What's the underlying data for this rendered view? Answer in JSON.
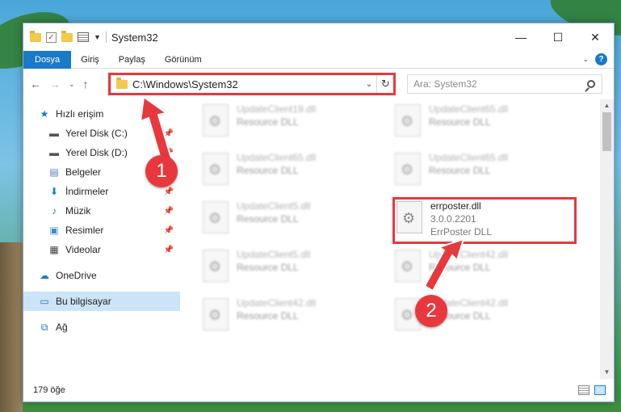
{
  "window": {
    "title": "System32",
    "controls": {
      "minimize": "—",
      "maximize": "☐",
      "close": "✕"
    }
  },
  "ribbon": {
    "tabs": [
      "Dosya",
      "Giriş",
      "Paylaş",
      "Görünüm"
    ],
    "help": "?"
  },
  "address": {
    "path": "C:\\Windows\\System32",
    "search_placeholder": "Ara: System32"
  },
  "sidebar": {
    "quick_access": "Hızlı erişim",
    "items": [
      {
        "label": "Yerel Disk (C:)",
        "icon": "drive-icon",
        "pinned": true
      },
      {
        "label": "Yerel Disk (D:)",
        "icon": "drive-icon",
        "pinned": true
      },
      {
        "label": "Belgeler",
        "icon": "documents-icon",
        "pinned": true
      },
      {
        "label": "İndirmeler",
        "icon": "download-icon",
        "pinned": true
      },
      {
        "label": "Müzik",
        "icon": "music-icon",
        "pinned": true
      },
      {
        "label": "Resimler",
        "icon": "pictures-icon",
        "pinned": true
      },
      {
        "label": "Videolar",
        "icon": "videos-icon",
        "pinned": true
      }
    ],
    "onedrive": "OneDrive",
    "this_pc": "Bu bilgisayar",
    "network": "Ağ"
  },
  "files": [
    {
      "name": "UpdateClient19.dll",
      "sub": "Resource DLL"
    },
    {
      "name": "UpdateClient65.dll",
      "sub": "Resource DLL"
    },
    {
      "name": "UpdateClient65.dll",
      "sub": "Resource DLL"
    },
    {
      "name": "UpdateClient65.dll",
      "sub": "Resource DLL"
    },
    {
      "name": "UpdateClient5.dll",
      "sub": "Resource DLL"
    },
    {
      "name": "errposter.dll",
      "version": "3.0.0.2201",
      "sub": "ErrPoster DLL"
    },
    {
      "name": "UpdateClient5.dll",
      "sub": "Resource DLL"
    },
    {
      "name": "UpdateClient42.dll",
      "sub": "Resource DLL"
    },
    {
      "name": "UpdateClient42.dll",
      "sub": "Resource DLL"
    },
    {
      "name": "UpdateClient42.dll",
      "sub": "Resource DLL"
    }
  ],
  "status": {
    "count": "179 öğe"
  },
  "annotations": {
    "step1": "1",
    "step2": "2"
  },
  "colors": {
    "accent": "#1979ca",
    "highlight": "#e8383d",
    "selected": "#cce4f7"
  }
}
